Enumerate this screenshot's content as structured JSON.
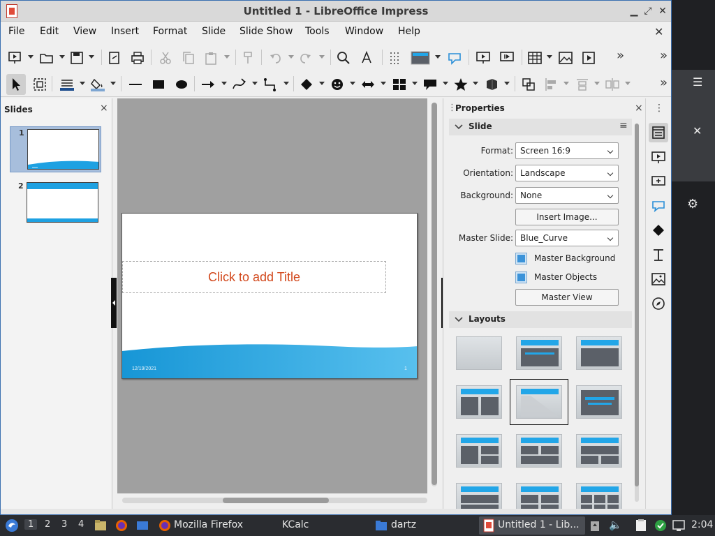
{
  "window": {
    "title": "Untitled 1 - LibreOffice Impress",
    "minimize_glyph": "▬",
    "maximize_glyph": "⤢",
    "close_glyph": "✕"
  },
  "menu": {
    "items": [
      "File",
      "Edit",
      "View",
      "Insert",
      "Format",
      "Slide",
      "Slide Show",
      "Tools",
      "Window",
      "Help"
    ],
    "close_glyph": "✕"
  },
  "slides_pane": {
    "title": "Slides",
    "close_glyph": "×",
    "thumbnails": [
      {
        "number": "1",
        "selected": true
      },
      {
        "number": "2",
        "selected": false
      }
    ]
  },
  "slide": {
    "title_placeholder": "Click to add Title",
    "date": "12/19/2021",
    "page_number": "1",
    "accent_color": "#1ea1e2"
  },
  "properties": {
    "title": "Properties",
    "close_glyph": "×",
    "menu_glyph": "⋮",
    "slide_section": {
      "title": "Slide",
      "collapse_glyph": "⌄",
      "menu_glyph": "≡",
      "format_label": "Format:",
      "format_value": "Screen 16:9",
      "orientation_label": "Orientation:",
      "orientation_value": "Landscape",
      "background_label": "Background:",
      "background_value": "None",
      "insert_image_label": "Insert Image...",
      "master_slide_label": "Master Slide:",
      "master_slide_value": "Blue_Curve",
      "master_background_label": "Master Background",
      "master_objects_label": "Master Objects",
      "master_view_label": "Master View"
    },
    "layouts_section": {
      "title": "Layouts",
      "collapse_glyph": "⌄"
    }
  },
  "sidebar_tabs": [
    "properties-tab",
    "slide-transition-tab",
    "animation-tab",
    "master-slides-tab",
    "shapes-tab",
    "styles-tab",
    "gallery-tab",
    "navigator-tab"
  ],
  "taskbar": {
    "workspaces": [
      "1",
      "2",
      "3",
      "4"
    ],
    "active_workspace": "1",
    "tasks": [
      "Mozilla Firefox",
      "KCalc",
      "dartz",
      "Untitled 1 - Lib..."
    ],
    "clock": "2:04"
  },
  "colors": {
    "accent": "#22a6e8",
    "title_placeholder": "#d2481c"
  }
}
